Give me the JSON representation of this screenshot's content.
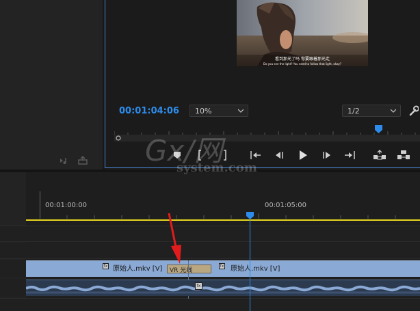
{
  "program_monitor": {
    "timecode": "00:01:04:06",
    "zoom_value": "10%",
    "resolution_value": "1/2"
  },
  "video_subtitle": {
    "line1": "看到那光了吗 你要跟着那光走",
    "line2": "Do you see the light? You need to follow that light, okay?"
  },
  "timeline": {
    "ruler_labels": [
      "00:01:00:00",
      "00:01:05:00"
    ],
    "clip_a_label": "原始人.mkv [V]",
    "clip_b_label": "原始人.mkv [V]",
    "transition_label": "VR 光线"
  },
  "watermark": {
    "line1": "Gx/网",
    "line2": "system.com"
  },
  "colors": {
    "accent_blue": "#2d8ceb",
    "clip_blue": "#8aa9d4",
    "work_area_yellow": "#e8d51f",
    "arrow_red": "#e21c1c"
  }
}
